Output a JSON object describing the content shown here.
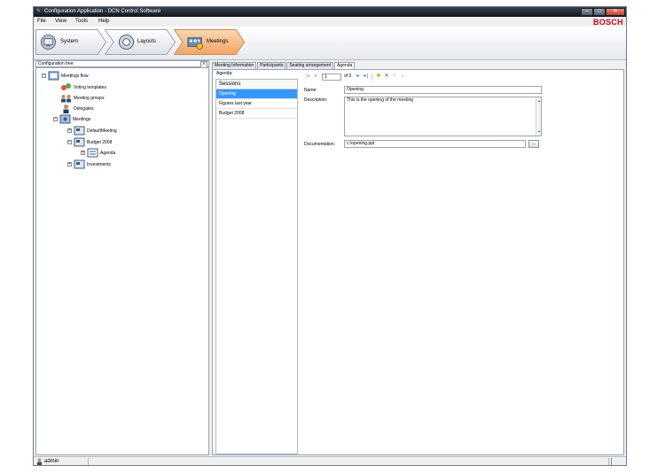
{
  "window": {
    "title": "Configuration Application - DCN Control Software",
    "brand": "BOSCH",
    "controls": {
      "minimize": "–",
      "maximize": "□",
      "close": "✕"
    }
  },
  "menu": [
    "File",
    "View",
    "Tools",
    "Help"
  ],
  "breadcrumb": [
    {
      "label": "System",
      "icon": "system-icon",
      "active": false
    },
    {
      "label": "Layouts",
      "icon": "layouts-icon",
      "active": false
    },
    {
      "label": "Meetings",
      "icon": "meetings-icon",
      "active": true
    }
  ],
  "tree": {
    "header": "Configuration tree",
    "collapse_button": "«",
    "items": [
      {
        "label": "Meetings flow",
        "expander": "−",
        "icon": "meetings-flow-icon"
      },
      {
        "label": "Voting templates",
        "expander": "",
        "icon": "voting-templates-icon"
      },
      {
        "label": "Meeting groups",
        "expander": "",
        "icon": "meeting-groups-icon"
      },
      {
        "label": "Delegates",
        "expander": "",
        "icon": "delegates-icon"
      },
      {
        "label": "Meetings",
        "expander": "−",
        "icon": "meetings-folder-icon"
      },
      {
        "label": "DefaultMeeting",
        "expander": "+",
        "icon": "meeting-icon"
      },
      {
        "label": "Budget 2008",
        "expander": "−",
        "icon": "meeting-icon"
      },
      {
        "label": "Agenda",
        "expander": "+",
        "icon": "agenda-icon"
      },
      {
        "label": "Investments",
        "expander": "+",
        "icon": "meeting-icon"
      }
    ]
  },
  "tabs": [
    {
      "label": "Meeting Information",
      "active": false
    },
    {
      "label": "Participants",
      "active": false
    },
    {
      "label": "Seating arrangement",
      "active": false
    },
    {
      "label": "Agenda",
      "active": true
    }
  ],
  "agenda": {
    "label": "Agenda:",
    "list_header": "Sessions",
    "sessions": [
      "Opening",
      "Figures last year",
      "Budget 2008"
    ],
    "selected_index": 0,
    "navigator": {
      "position": "1",
      "of_label": "of 3"
    },
    "fields": {
      "name_label": "Name:",
      "name_value": "Opening",
      "description_label": "Description:",
      "description_value": "This is the opening of the meeting",
      "documentation_label": "Documentation:",
      "documentation_value": "c:\\opening.ppt",
      "browse_label": "..."
    }
  },
  "status": {
    "user": "admin"
  },
  "colors": {
    "selection": "#3399ff",
    "brand": "#d4001a",
    "active_crumb": "#f5b37a"
  }
}
